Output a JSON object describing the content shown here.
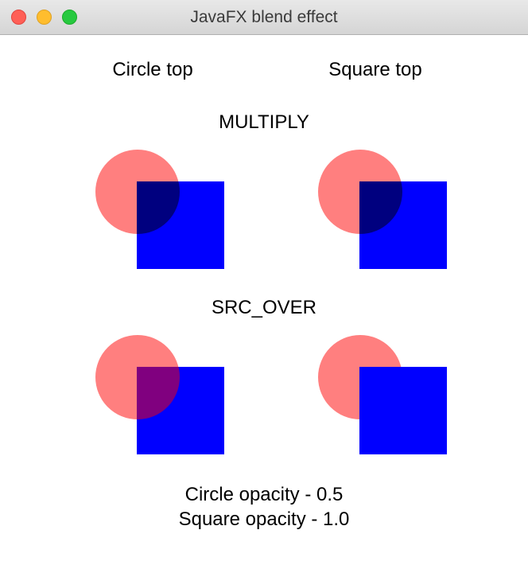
{
  "window": {
    "title": "JavaFX blend effect"
  },
  "columns": {
    "left": "Circle top",
    "right": "Square top"
  },
  "sections": {
    "multiply": "MULTIPLY",
    "srcOver": "SRC_OVER"
  },
  "footer": {
    "line1": "Circle opacity - 0.5",
    "line2": "Square opacity - 1.0"
  },
  "shapes": {
    "circle_color": "#ff0000",
    "circle_opacity": 0.5,
    "square_color": "#0000ff",
    "square_opacity": 1.0
  }
}
